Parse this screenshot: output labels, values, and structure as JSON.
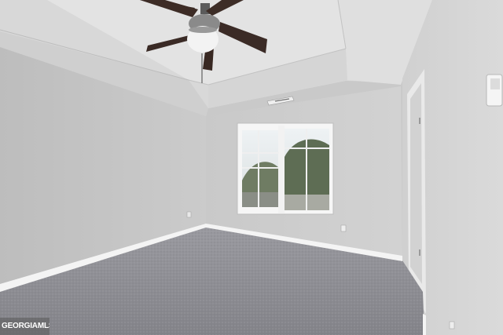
{
  "scene": {
    "description_tag": "empty-bedroom-photo",
    "colors": {
      "wall_left": "#c6c6c6",
      "wall_back": "#cfcfcf",
      "wall_right": "#d6d6d6",
      "ceiling": "#dcdcdc",
      "carpet": "#8e8e93",
      "baseboard": "#f2f2f2",
      "fan_blade": "#3a2a25",
      "window_frame": "#f4f4f4",
      "trees": "#5f6e55"
    }
  },
  "watermark": {
    "text": "GEORGIAMLS"
  }
}
